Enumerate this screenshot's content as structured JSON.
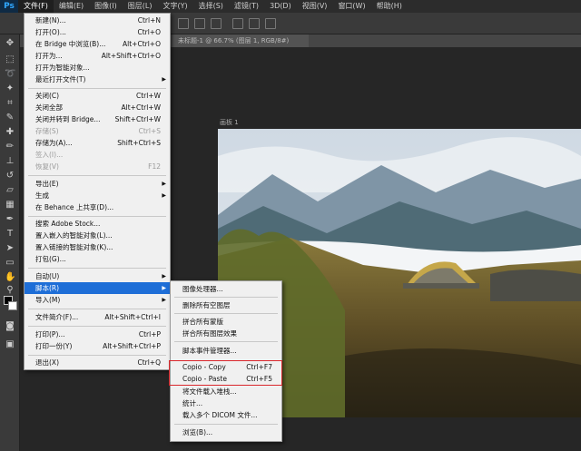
{
  "app": {
    "logo": "Ps"
  },
  "menubar": {
    "items": [
      "文件(F)",
      "编辑(E)",
      "图像(I)",
      "图层(L)",
      "文字(Y)",
      "选择(S)",
      "滤镜(T)",
      "3D(D)",
      "视图(V)",
      "窗口(W)",
      "帮助(H)"
    ]
  },
  "document": {
    "tab_title": "未标题-1 @ 66.7% (图层 1, RGB/8#)",
    "artboard_label": "画板 1"
  },
  "file_menu": {
    "items": [
      {
        "label": "新建(N)...",
        "shortcut": "Ctrl+N"
      },
      {
        "label": "打开(O)...",
        "shortcut": "Ctrl+O"
      },
      {
        "label": "在 Bridge 中浏览(B)...",
        "shortcut": "Alt+Ctrl+O"
      },
      {
        "label": "打开为...",
        "shortcut": "Alt+Shift+Ctrl+O"
      },
      {
        "label": "打开为智能对象...",
        "shortcut": ""
      },
      {
        "label": "最近打开文件(T)",
        "shortcut": ""
      },
      {
        "label": "关闭(C)",
        "shortcut": "Ctrl+W"
      },
      {
        "label": "关闭全部",
        "shortcut": "Alt+Ctrl+W"
      },
      {
        "label": "关闭并转到 Bridge...",
        "shortcut": "Shift+Ctrl+W"
      },
      {
        "label": "存储(S)",
        "shortcut": "Ctrl+S"
      },
      {
        "label": "存储为(A)...",
        "shortcut": "Shift+Ctrl+S"
      },
      {
        "label": "签入(I)...",
        "shortcut": ""
      },
      {
        "label": "恢复(V)",
        "shortcut": "F12"
      },
      {
        "label": "导出(E)",
        "shortcut": ""
      },
      {
        "label": "生成",
        "shortcut": ""
      },
      {
        "label": "在 Behance 上共享(D)...",
        "shortcut": ""
      },
      {
        "label": "搜索 Adobe Stock...",
        "shortcut": ""
      },
      {
        "label": "置入嵌入的智能对象(L)...",
        "shortcut": ""
      },
      {
        "label": "置入链接的智能对象(K)...",
        "shortcut": ""
      },
      {
        "label": "打包(G)...",
        "shortcut": ""
      },
      {
        "label": "自动(U)",
        "shortcut": ""
      },
      {
        "label": "脚本(R)",
        "shortcut": ""
      },
      {
        "label": "导入(M)",
        "shortcut": ""
      },
      {
        "label": "文件简介(F)...",
        "shortcut": "Alt+Shift+Ctrl+I"
      },
      {
        "label": "打印(P)...",
        "shortcut": "Ctrl+P"
      },
      {
        "label": "打印一份(Y)",
        "shortcut": "Alt+Shift+Ctrl+P"
      },
      {
        "label": "退出(X)",
        "shortcut": "Ctrl+Q"
      }
    ]
  },
  "scripts_submenu": {
    "items": [
      {
        "label": "图像处理器...",
        "shortcut": ""
      },
      {
        "label": "删除所有空图层",
        "shortcut": ""
      },
      {
        "label": "拼合所有蒙版",
        "shortcut": ""
      },
      {
        "label": "拼合所有图层效果",
        "shortcut": ""
      },
      {
        "label": "脚本事件管理器...",
        "shortcut": ""
      },
      {
        "label": "Copio - Copy",
        "shortcut": "Ctrl+F7"
      },
      {
        "label": "Copio - Paste",
        "shortcut": "Ctrl+F5"
      },
      {
        "label": "将文件载入堆栈...",
        "shortcut": ""
      },
      {
        "label": "统计...",
        "shortcut": ""
      },
      {
        "label": "载入多个 DICOM 文件...",
        "shortcut": ""
      },
      {
        "label": "浏览(B)...",
        "shortcut": ""
      }
    ]
  },
  "colors": {
    "highlight": "#1e6ed7",
    "annotation": "#d9262b"
  }
}
